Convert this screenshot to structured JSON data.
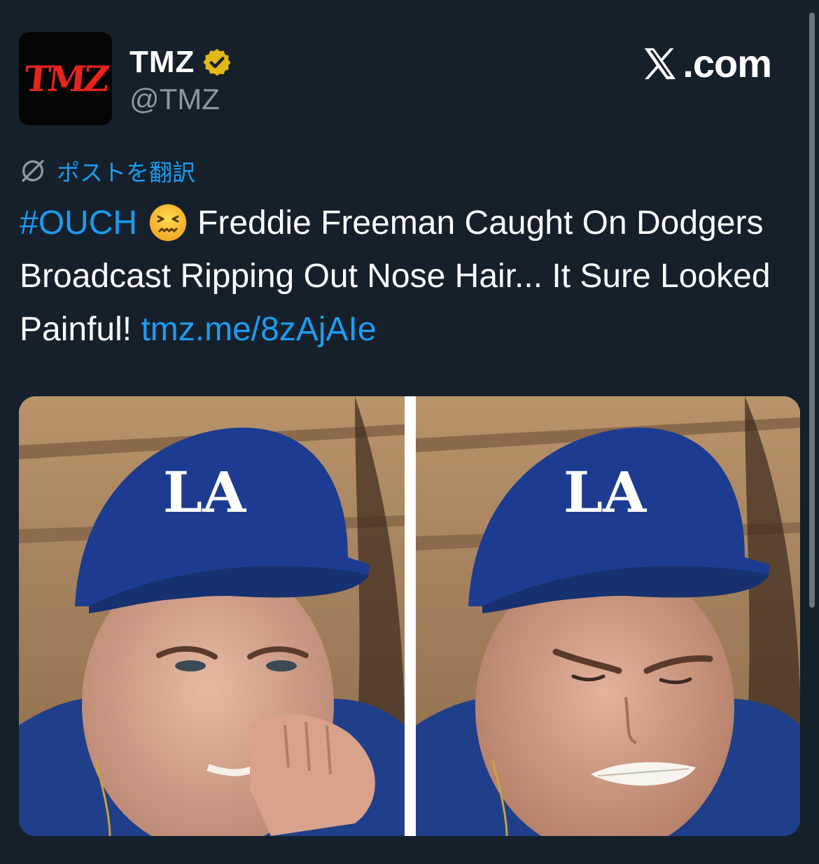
{
  "account": {
    "avatar_text": "TMZ",
    "display_name": "TMZ",
    "handle": "@TMZ",
    "verified": true,
    "verified_badge_color": "#e2b719"
  },
  "site_logo": ".com",
  "translate_label": "ポストを翻訳",
  "tweet": {
    "hashtag": "#OUCH",
    "emoji": "confounded-face",
    "text": "Freddie Freeman Caught On Dodgers Broadcast Ripping Out Nose Hair... It Sure Looked Painful!",
    "link": "tmz.me/8zAjAIe"
  },
  "media": {
    "images": [
      {
        "name": "freddie-freeman-nose-pick-image",
        "cap_logo": "LA"
      },
      {
        "name": "freddie-freeman-grimace-image",
        "cap_logo": "LA"
      }
    ]
  },
  "colors": {
    "background": "#15202b",
    "link": "#1d9bf0",
    "secondary_text": "#8b98a5",
    "tmz_red": "#e8231c"
  }
}
